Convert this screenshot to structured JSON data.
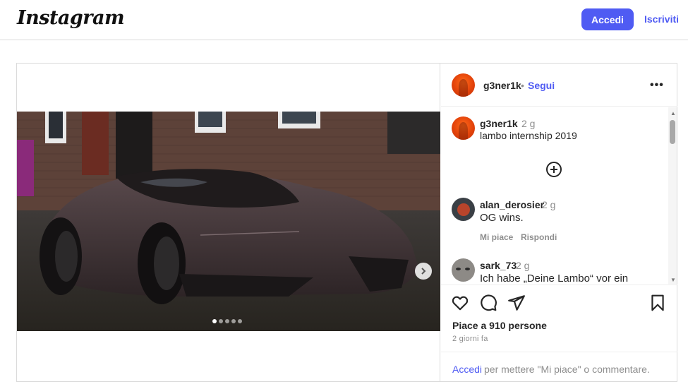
{
  "header": {
    "logo": "Instagram",
    "login_label": "Accedi",
    "signup_label": "Iscriviti"
  },
  "colors": {
    "accent": "#4f5bf3",
    "text": "#262626",
    "muted": "#8e8e8e",
    "border": "#dbdbdb"
  },
  "post": {
    "author": "g3ner1k",
    "separator": "•",
    "follow_label": "Segui",
    "more_icon": "more-horizontal-icon",
    "carousel": {
      "current": 1,
      "total": 5
    },
    "caption": {
      "user": "g3ner1k",
      "time": "2 g",
      "text": "lambo internship 2019"
    },
    "comments": [
      {
        "user": "alan_derosier",
        "time": "2 g",
        "text": "OG wins.",
        "like_label": "Mi piace",
        "reply_label": "Rispondi"
      },
      {
        "user": "sark_73",
        "time": "2 g",
        "text": "Ich habe „Deine Lambo“ vor ein"
      }
    ],
    "likes_text": "Piace a 910 persone",
    "time_ago": "2 giorni fa",
    "login_prompt": {
      "link": "Accedi",
      "rest": "per mettere \"Mi piace\" o commentare."
    }
  }
}
